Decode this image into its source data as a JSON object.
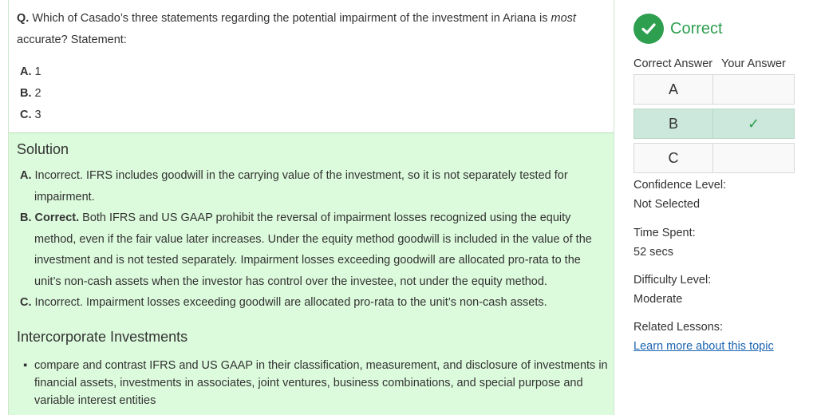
{
  "question": {
    "prefix": "Q.",
    "text_before": " Which of Casado’s three statements regarding the potential impairment of the investment in Ariana is ",
    "text_italic": "most",
    "text_line2": "accurate? Statement:",
    "options": [
      {
        "letter": "A.",
        "value": "1"
      },
      {
        "letter": "B.",
        "value": "2"
      },
      {
        "letter": "C.",
        "value": "3"
      }
    ]
  },
  "solution": {
    "title": "Solution",
    "items": [
      {
        "label": "A.",
        "bold_text": "",
        "text": " Incorrect. IFRS includes goodwill in the carrying value of the investment, so it is not separately tested for impairment."
      },
      {
        "label": "B. Correct.",
        "bold_text": "",
        "text": " Both IFRS and US GAAP prohibit the reversal of impairment losses recognized using the equity method, even if the fair value later increases. Under the equity method goodwill is included in the value of the investment and is not tested separately. Impairment losses exceeding goodwill are allocated pro-rata to the unit’s non-cash assets when the investor has control over the investee, not under the equity method."
      },
      {
        "label": "C.",
        "bold_text": "",
        "text": " Incorrect. Impairment losses exceeding goodwill are allocated pro-rata to the unit’s non-cash assets."
      }
    ]
  },
  "topic": {
    "title": "Intercorporate Investments",
    "bullets": [
      "compare and contrast IFRS and US GAAP in their classification, measurement, and disclosure of investments in financial assets, investments in associates, joint ventures, business combinations, and special purpose and variable interest entities"
    ]
  },
  "result": {
    "status": "Correct",
    "status_color": "#2e9e4f",
    "col_correct": "Correct Answer",
    "col_yours": "Your Answer",
    "rows": [
      {
        "letter": "A",
        "mark": ""
      },
      {
        "letter": "B",
        "mark": "✓"
      },
      {
        "letter": "C",
        "mark": ""
      }
    ],
    "confidence_label": "Confidence Level:",
    "confidence_value": "Not Selected",
    "time_label": "Time Spent:",
    "time_value": "52 secs",
    "difficulty_label": "Difficulty Level:",
    "difficulty_value": "Moderate",
    "related_label": "Related Lessons:",
    "related_link": "Learn more about this topic"
  },
  "colors": {
    "solution_bg": "#dcfadc",
    "accent_green": "#2e9e4f",
    "selected_row": "#cce8dc",
    "link": "#1a63b0"
  }
}
